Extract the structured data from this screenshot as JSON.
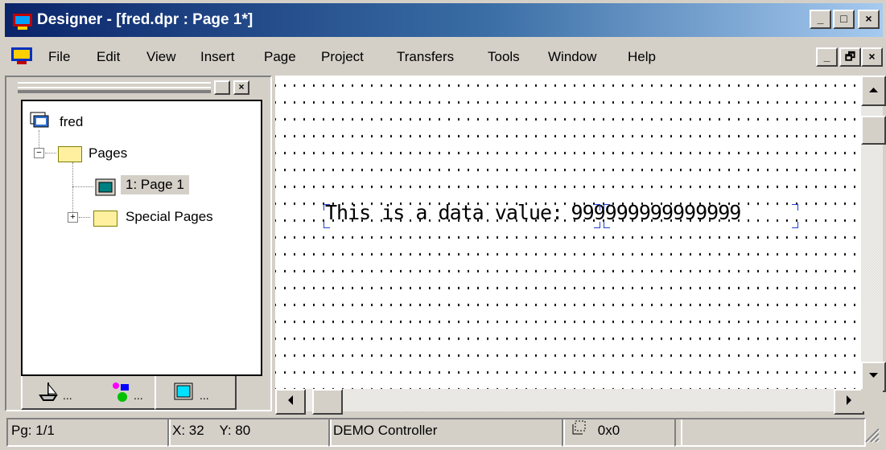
{
  "window": {
    "title": "Designer - [fred.dpr : Page 1*]",
    "caption_buttons": {
      "minimize": "_",
      "maximize": "□",
      "close": "×"
    }
  },
  "menubar": {
    "items": [
      "File",
      "Edit",
      "View",
      "Insert",
      "Page",
      "Project",
      "Transfers",
      "Tools",
      "Window",
      "Help"
    ],
    "child_buttons": {
      "minimize": "_",
      "restore": "🗗",
      "close": "×"
    }
  },
  "tree": {
    "root": "fred",
    "pages_folder": "Pages",
    "page_item": "1: Page 1",
    "special_folder": "Special Pages",
    "expand_minus": "−",
    "expand_plus": "+"
  },
  "tabs": [
    "...",
    "...",
    "..."
  ],
  "canvas": {
    "label": "This is a data value:",
    "value": "999999999999999"
  },
  "statusbar": {
    "page": "Pg: 1/1",
    "x": "X: 32",
    "y": "Y: 80",
    "controller": "DEMO Controller",
    "size": "0x0"
  },
  "colors": {
    "titlebar_start": "#0a246a",
    "titlebar_end": "#a6caf0",
    "selection": "#d4d0c8"
  }
}
